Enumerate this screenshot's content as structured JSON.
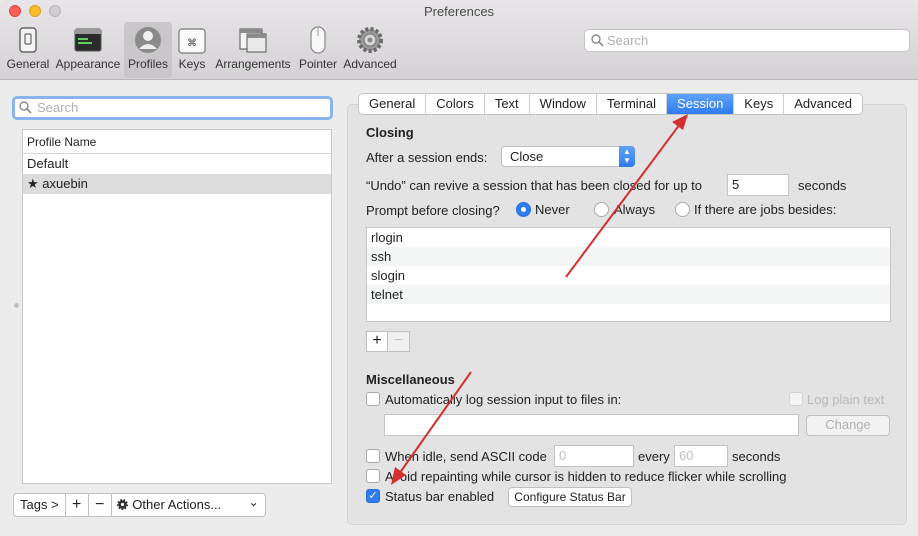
{
  "window": {
    "title": "Preferences"
  },
  "toolbar": {
    "items": [
      {
        "label": "General",
        "icon": "general-icon"
      },
      {
        "label": "Appearance",
        "icon": "appearance-icon"
      },
      {
        "label": "Profiles",
        "icon": "profiles-icon",
        "selected": true
      },
      {
        "label": "Keys",
        "icon": "keys-icon"
      },
      {
        "label": "Arrangements",
        "icon": "arrangements-icon"
      },
      {
        "label": "Pointer",
        "icon": "pointer-icon"
      },
      {
        "label": "Advanced",
        "icon": "advanced-gear-icon"
      }
    ],
    "search_placeholder": "Search"
  },
  "profiles_pane": {
    "search_placeholder": "Search",
    "column_header": "Profile Name",
    "profiles": [
      {
        "name": "Default",
        "star": ""
      },
      {
        "name": "axuebin",
        "star": "★",
        "selected": true
      }
    ],
    "tags_label": "Tags >",
    "add_label": "+",
    "remove_label": "−",
    "other_actions_label": "Other Actions...",
    "other_actions_chevron": "⌄"
  },
  "tabs": [
    {
      "label": "General"
    },
    {
      "label": "Colors"
    },
    {
      "label": "Text"
    },
    {
      "label": "Window"
    },
    {
      "label": "Terminal"
    },
    {
      "label": "Session",
      "selected": true
    },
    {
      "label": "Keys"
    },
    {
      "label": "Advanced"
    }
  ],
  "closing": {
    "heading": "Closing",
    "after_ends_label": "After a session ends:",
    "after_ends_value": "Close",
    "undo_label": "“Undo” can revive a session that has been closed for up to",
    "undo_value": "5",
    "undo_unit": "seconds",
    "prompt_label": "Prompt before closing?",
    "prompt_options": [
      "Never",
      "Always",
      "If there are jobs besides:"
    ],
    "prompt_selected": "Never",
    "jobs": [
      "rlogin",
      "ssh",
      "slogin",
      "telnet"
    ],
    "add_label": "+",
    "remove_label": "−"
  },
  "misc": {
    "heading": "Miscellaneous",
    "autolog_label": "Automatically log session input to files in:",
    "autolog_checked": false,
    "log_plain_label": "Log plain text",
    "change_label": "Change",
    "idle_label": "When idle, send ASCII code",
    "idle_code_placeholder": "0",
    "idle_every_label": "every",
    "idle_seconds_placeholder": "60",
    "idle_unit": "seconds",
    "idle_checked": false,
    "avoid_label": "Avoid repainting while cursor is hidden to reduce flicker while scrolling",
    "avoid_checked": false,
    "status_bar_label": "Status bar enabled",
    "status_bar_checked": true,
    "configure_label": "Configure Status Bar"
  },
  "colors": {
    "accent": "#2f7cf0",
    "annotation_arrow": "#d32f2f"
  }
}
